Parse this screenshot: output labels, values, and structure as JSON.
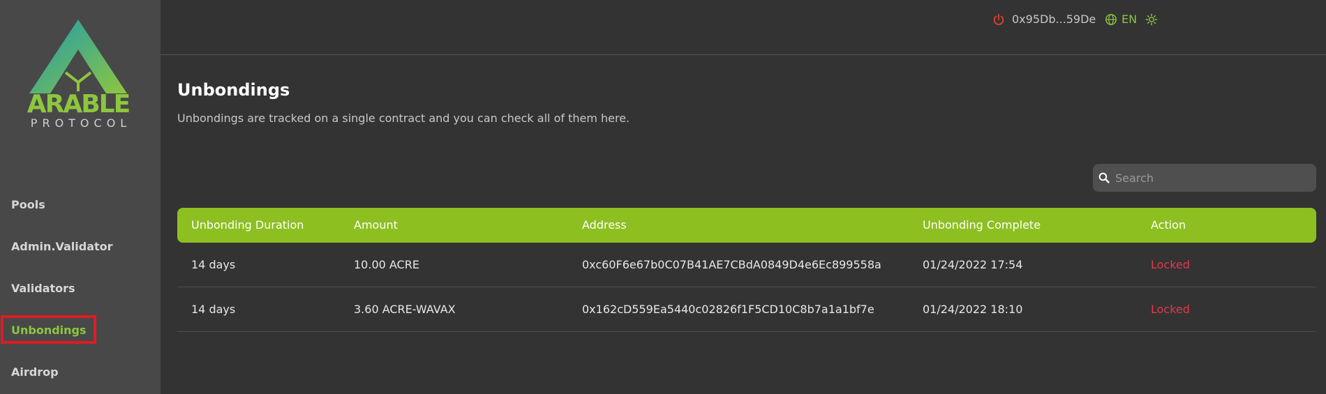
{
  "brand": {
    "name": "ARABLE",
    "subtitle": "PROTOCOL"
  },
  "sidebar": {
    "items": [
      {
        "label": "Pools",
        "active": false
      },
      {
        "label": "Admin.Validator",
        "active": false
      },
      {
        "label": "Validators",
        "active": false
      },
      {
        "label": "Unbondings",
        "active": true
      },
      {
        "label": "Airdrop",
        "active": false
      }
    ]
  },
  "topbar": {
    "wallet_address": "0x95Db...59De",
    "language": "EN"
  },
  "page": {
    "title": "Unbondings",
    "description": "Unbondings are tracked on a single contract and you can check all of them here."
  },
  "search": {
    "placeholder": "Search",
    "value": ""
  },
  "table": {
    "headers": [
      "Unbonding Duration",
      "Amount",
      "Address",
      "Unbonding Complete",
      "Action"
    ],
    "rows": [
      [
        "14 days",
        "10.00 ACRE",
        "0xc60F6e67b0C07B41AE7CBdA0849D4e6Ec899558a",
        "01/24/2022 17:54",
        "Locked"
      ],
      [
        "14 days",
        "3.60 ACRE-WAVAX",
        "0x162cD559Ea5440c02826f1F5CD10C8b7a1a1bf7e",
        "01/24/2022 18:10",
        "Locked"
      ]
    ]
  },
  "colors": {
    "accent": "#8dc63f",
    "header_bar": "#8dbf21",
    "locked": "#e5374d",
    "highlight": "#e01b24",
    "power_icon": "#e0432c"
  }
}
